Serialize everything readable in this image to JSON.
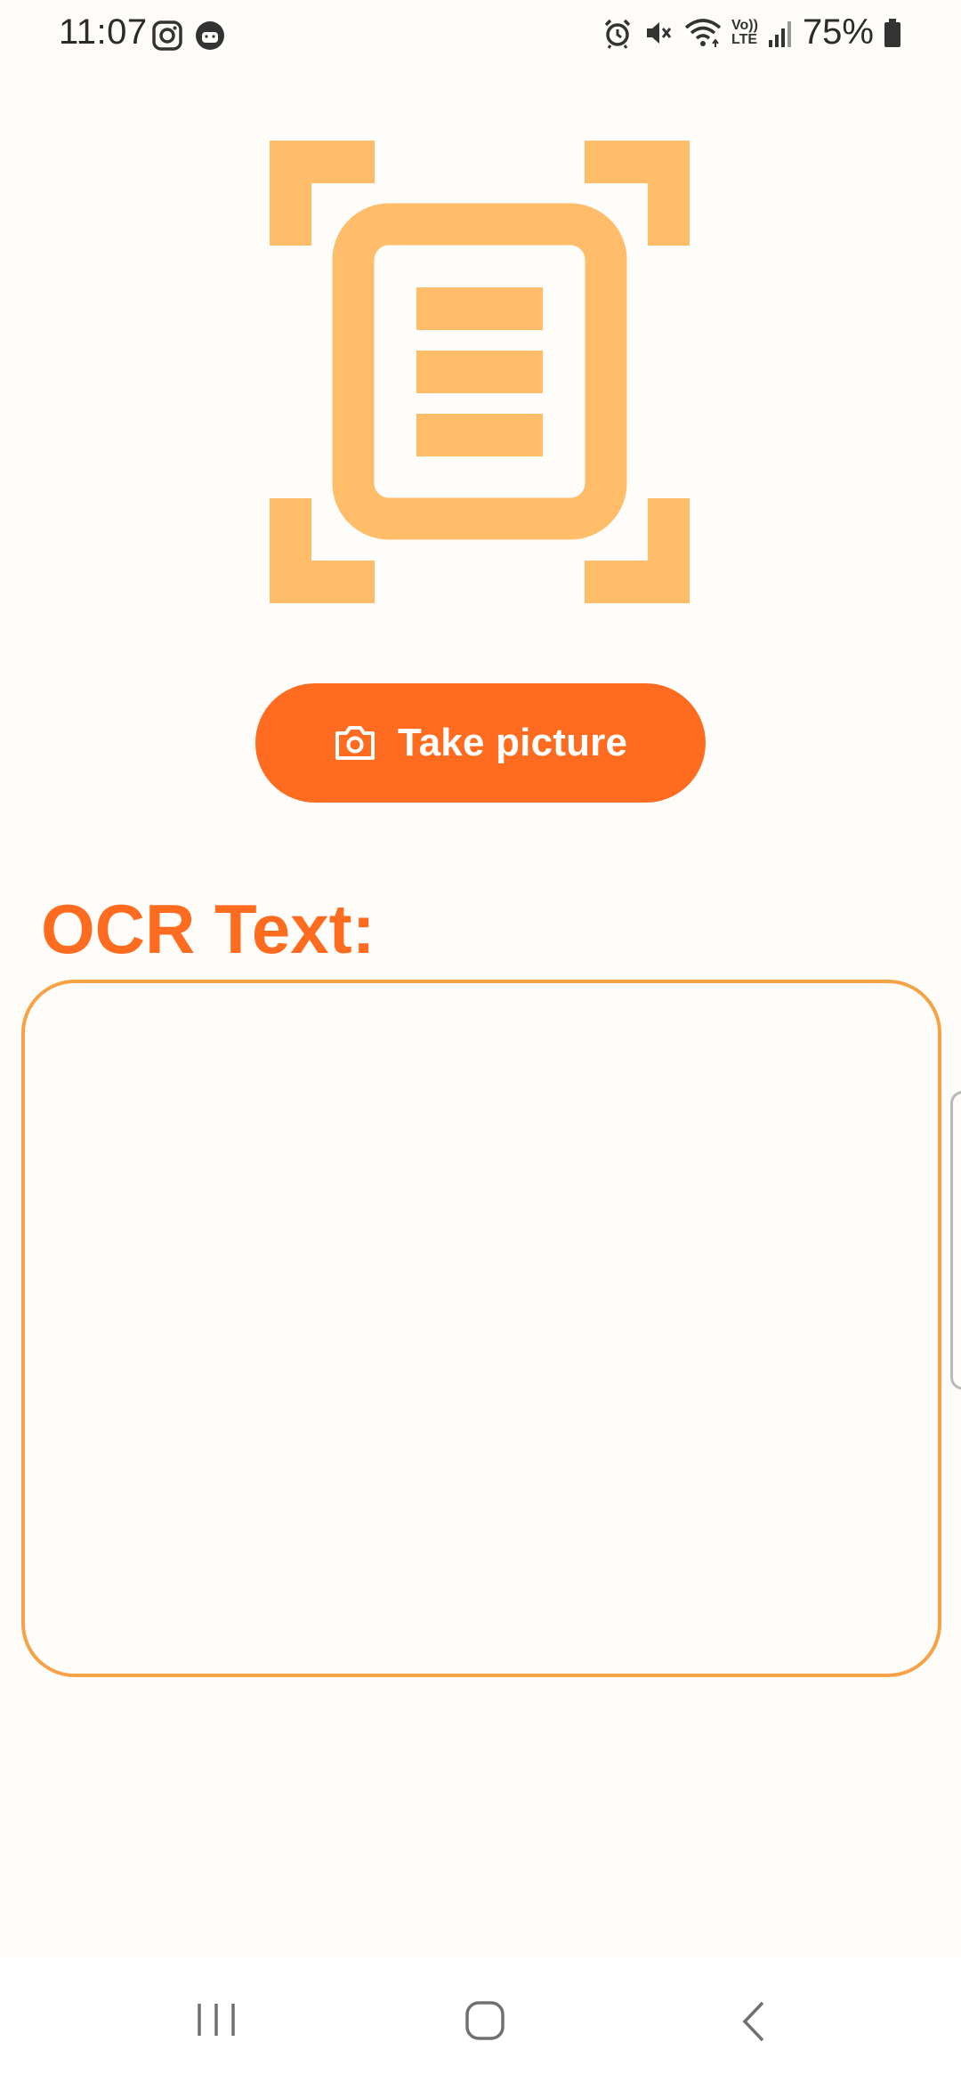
{
  "status_bar": {
    "time": "11:07",
    "battery": "75%",
    "left_icons": [
      "instagram-icon",
      "notification-app-icon"
    ],
    "right_icons": [
      "alarm-icon",
      "mute-icon",
      "wifi-icon",
      "volte-icon",
      "signal-icon",
      "battery-icon"
    ],
    "volte_label_top": "Vo))",
    "volte_label_bottom": "LTE"
  },
  "hero": {
    "icon": "document-scanner-icon",
    "color": "#FFBC69"
  },
  "take_picture_button": {
    "label": "Take picture",
    "icon": "camera-icon",
    "color": "#FF6B1F"
  },
  "ocr": {
    "title": "OCR Text:",
    "value": "",
    "border_color": "#F7A247"
  },
  "nav_bar": {
    "items": [
      "recent-apps-icon",
      "home-icon",
      "back-icon"
    ]
  }
}
